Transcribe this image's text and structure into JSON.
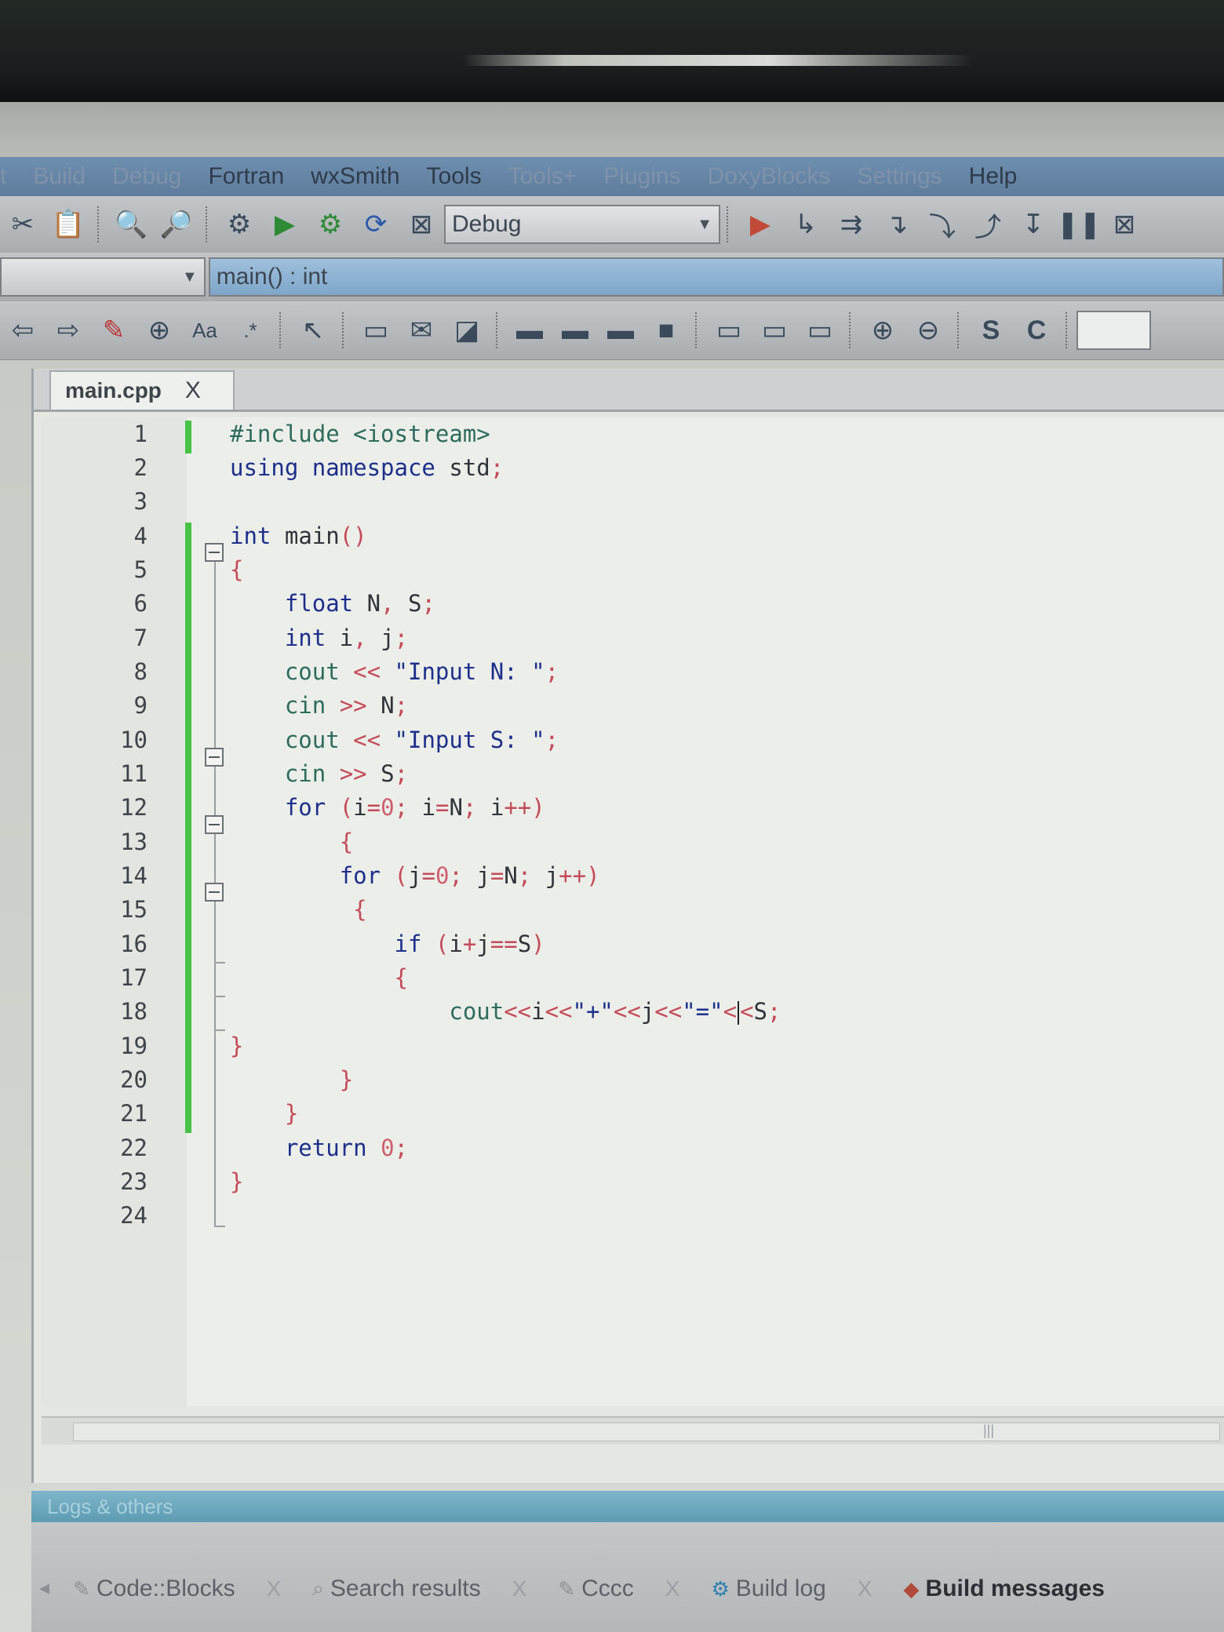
{
  "menubar": {
    "items": [
      "t",
      "Build",
      "Debug",
      "Fortran",
      "wxSmith",
      "Tools",
      "Tools+",
      "Plugins",
      "DoxyBlocks",
      "Settings",
      "Help"
    ]
  },
  "toolbar": {
    "build_target": "Debug"
  },
  "scope": {
    "function": "main() : int"
  },
  "editor": {
    "tab_label": "main.cpp",
    "tab_close": "X"
  },
  "code": {
    "line_numbers": [
      "1",
      "2",
      "3",
      "4",
      "5",
      "6",
      "7",
      "8",
      "9",
      "10",
      "11",
      "12",
      "13",
      "14",
      "15",
      "16",
      "17",
      "18",
      "19",
      "20",
      "21",
      "22",
      "23",
      "24"
    ]
  },
  "logs": {
    "header": "Logs & others",
    "tabs": [
      "Code::Blocks",
      "Search results",
      "Cccc",
      "Build log",
      "Build messages"
    ],
    "close": "X"
  },
  "colors": {
    "keyword": "#1d2f8a",
    "preprocessor": "#2d6b5a",
    "operator": "#c44b5a",
    "number": "#cf5f6f",
    "change_bar": "#48c244",
    "menubar": "#6f8fb0"
  }
}
